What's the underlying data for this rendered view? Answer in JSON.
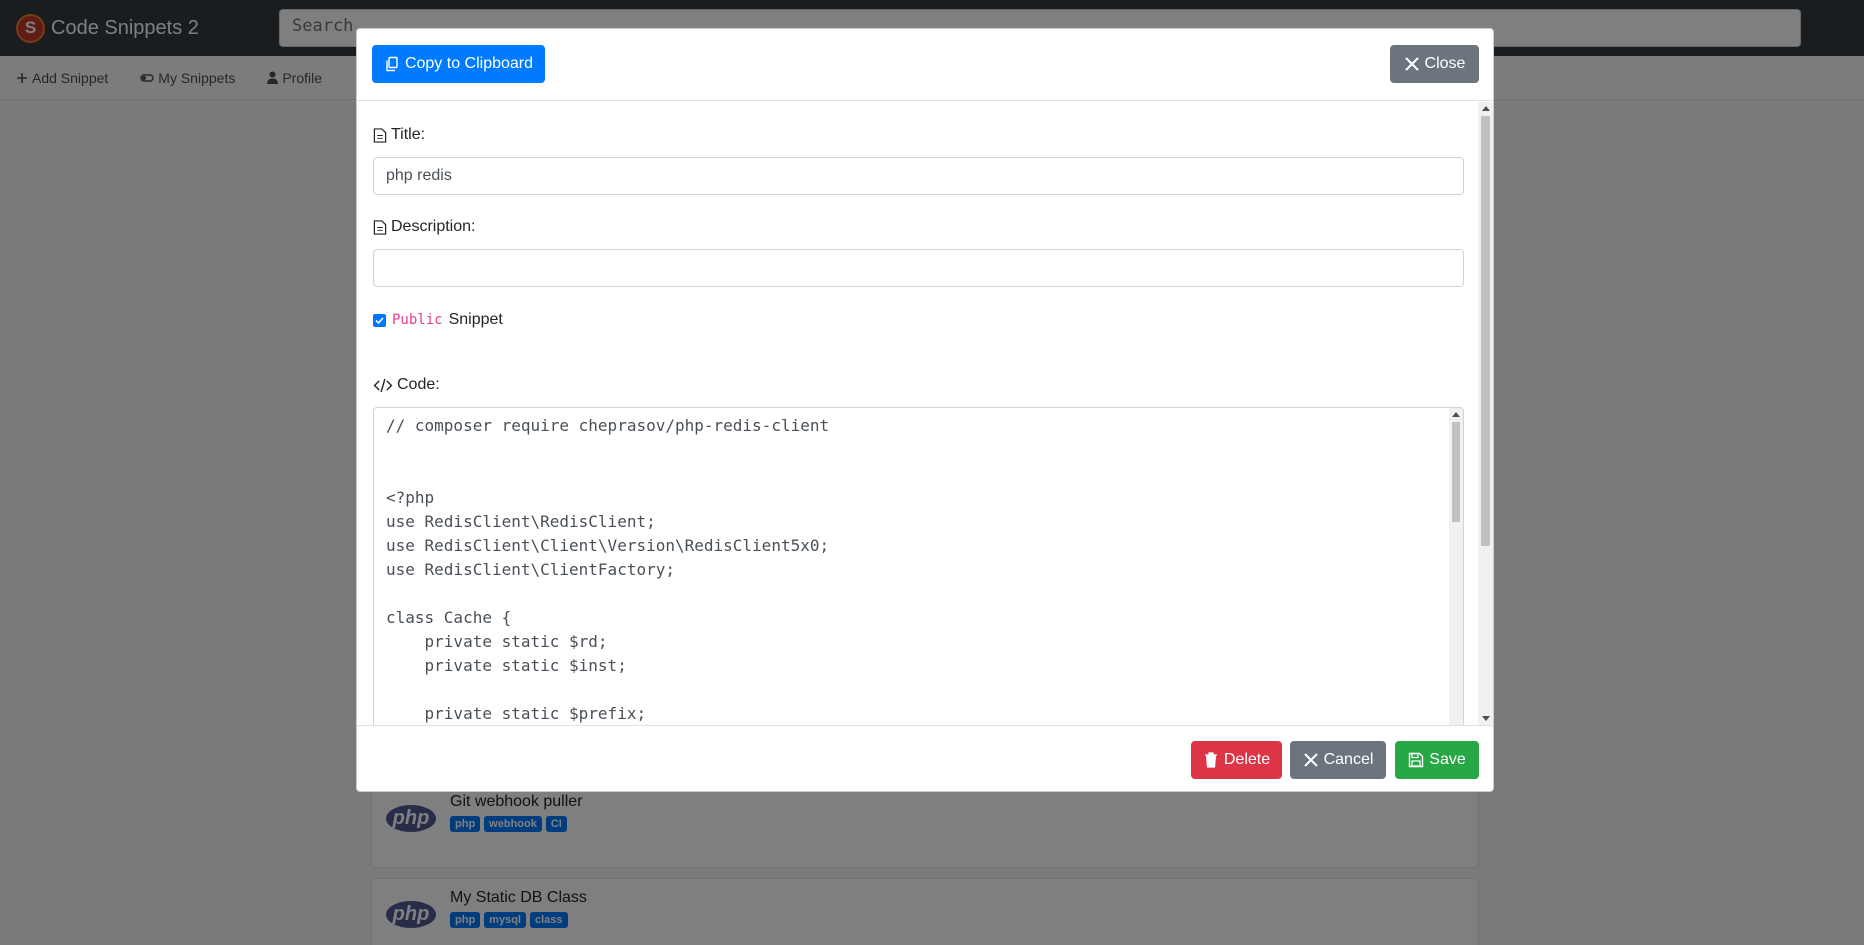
{
  "app": {
    "title": "Code Snippets 2",
    "logo_letter": "S",
    "search_placeholder": "Search"
  },
  "subnav": {
    "items": [
      {
        "label": "Add Snippet",
        "icon": "plus-icon"
      },
      {
        "label": "My Snippets",
        "icon": "toggle-icon"
      },
      {
        "label": "Profile",
        "icon": "person-icon"
      }
    ]
  },
  "cards": [
    {
      "title": "Git webhook puller",
      "logo": "php",
      "tags": [
        "php",
        "webhook",
        "CI"
      ]
    },
    {
      "title": "My Static DB Class",
      "logo": "php",
      "tags": [
        "php",
        "mysql",
        "class"
      ]
    }
  ],
  "modal": {
    "copy_label": "Copy to Clipboard",
    "close_label": "Close",
    "title_label": "Title:",
    "title_value": "php redis",
    "description_label": "Description:",
    "description_value": "",
    "public_checked": true,
    "public_keyword": "Public",
    "public_suffix": "Snippet",
    "code_label": "Code:",
    "code_value": "// composer require cheprasov/php-redis-client\n\n\n<?php\nuse RedisClient\\RedisClient;\nuse RedisClient\\Client\\Version\\RedisClient5x0;\nuse RedisClient\\ClientFactory;\n\nclass Cache {\n    private static $rd;\n    private static $inst;\n\n    private static $prefix;\n",
    "delete_label": "Delete",
    "cancel_label": "Cancel",
    "save_label": "Save"
  },
  "colors": {
    "primary": "#007bff",
    "secondary": "#6c757d",
    "danger": "#dc3545",
    "success": "#28a745",
    "navbar": "#343a40"
  }
}
